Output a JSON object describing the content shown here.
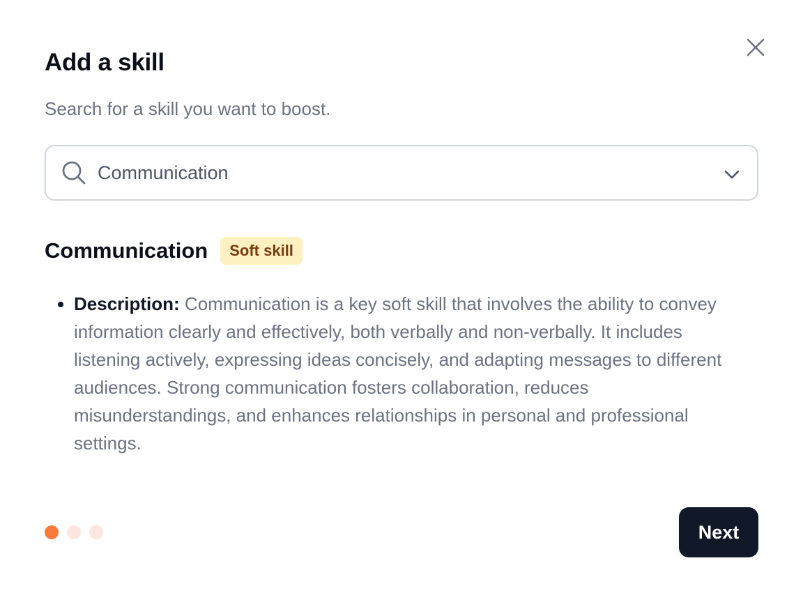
{
  "dialog": {
    "title": "Add a skill",
    "subtitle": "Search for a skill you want to boost.",
    "close_icon": "close-icon"
  },
  "search": {
    "value": "Communication",
    "icon": "search-icon",
    "dropdown_icon": "chevron-down-icon"
  },
  "skill": {
    "name": "Communication",
    "badge": "Soft skill",
    "description_label": "Description:",
    "description_text": " Communication is a key soft skill that involves the ability to convey information clearly and effectively, both verbally and non-verbally. It includes listening actively, expressing ideas concisely, and adapting messages to different audiences. Strong communication fosters collaboration, reduces misunderstandings, and enhances relationships in personal and professional settings."
  },
  "pagination": {
    "current_step": 1,
    "total_steps": 3
  },
  "footer": {
    "next_label": "Next"
  },
  "colors": {
    "primary_button": "#111827",
    "badge_bg": "#fdf1c2",
    "badge_text": "#7a3a10",
    "step_active": "#f97a3f",
    "step_inactive": "#fde6df"
  }
}
